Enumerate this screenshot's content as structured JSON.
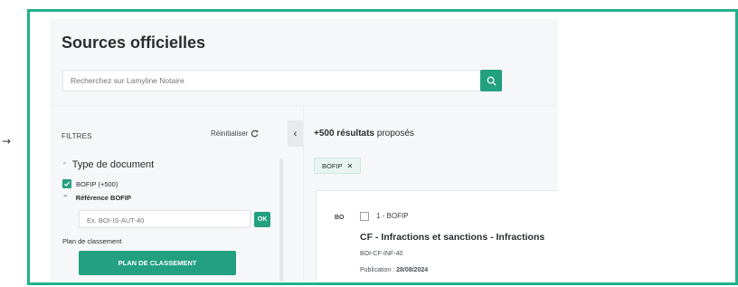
{
  "page": {
    "title": "Sources officielles"
  },
  "search": {
    "placeholder": "Recherchez sur Lamyline Notaire",
    "icon": "search-icon"
  },
  "filters": {
    "label": "FILTRES",
    "reset_label": "Réinitialiser",
    "reset_icon": "refresh-icon",
    "collapse_icon": "chevron-left-icon",
    "document_type": {
      "label": "Type de document",
      "options": [
        {
          "label": "BOFIP (+500)",
          "checked": true
        }
      ]
    },
    "reference": {
      "label": "Référence BOFIP",
      "placeholder": "Ex. BOI-IS-AUT-40",
      "ok_label": "OK"
    },
    "plan": {
      "label": "Plan de classement",
      "button_label": "PLAN DE CLASSEMENT"
    }
  },
  "results": {
    "count_bold": "+500 résultats",
    "count_suffix": " proposés",
    "active_chip": "BOFIP",
    "items": [
      {
        "source_badge": "BO",
        "number_label": "1 - BOFIP",
        "title": "CF - Infractions et sanctions - Infractions",
        "reference": "BOI-CF-INF-40",
        "publication_label": "Publication : ",
        "publication_date": "28/08/2024"
      }
    ]
  },
  "colors": {
    "accent": "#22a07f",
    "frame_border": "#22b08d"
  }
}
